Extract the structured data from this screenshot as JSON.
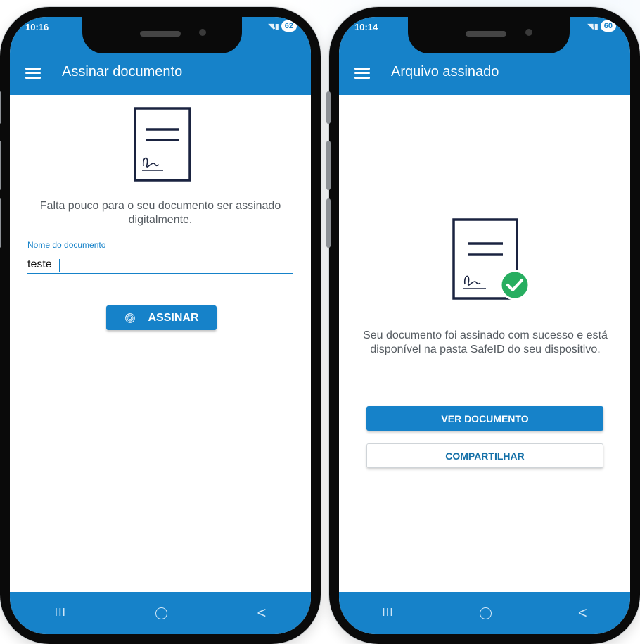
{
  "left_screen": {
    "status": {
      "time": "10:16",
      "signal": "◥.▮",
      "battery": "62"
    },
    "appbar": {
      "title": "Assinar documento"
    },
    "message": "Falta pouco para o seu documento ser assinado digitalmente.",
    "field": {
      "label": "Nome do documento",
      "value": "teste"
    },
    "sign_button": {
      "label": "ASSINAR"
    },
    "nav": {
      "recents": "III",
      "back": "<"
    }
  },
  "right_screen": {
    "status": {
      "time": "10:14",
      "signal": "◥.▮",
      "battery": "60"
    },
    "appbar": {
      "title": "Arquivo assinado"
    },
    "message": "Seu documento foi assinado com sucesso e está disponível na pasta SafeID do seu dispositivo.",
    "view_button": {
      "label": "VER DOCUMENTO"
    },
    "share_button": {
      "label": "COMPARTILHAR"
    },
    "nav": {
      "recents": "III",
      "back": "<"
    }
  },
  "colors": {
    "primary": "#1682c9",
    "document_stroke": "#1a2340",
    "success": "#27ae60",
    "text_secondary": "#555b61"
  },
  "icons": [
    "menu-icon",
    "document-icon",
    "signature-icon",
    "fingerprint-icon",
    "check-circle-icon",
    "wifi-icon",
    "signal-icon",
    "battery-icon"
  ]
}
